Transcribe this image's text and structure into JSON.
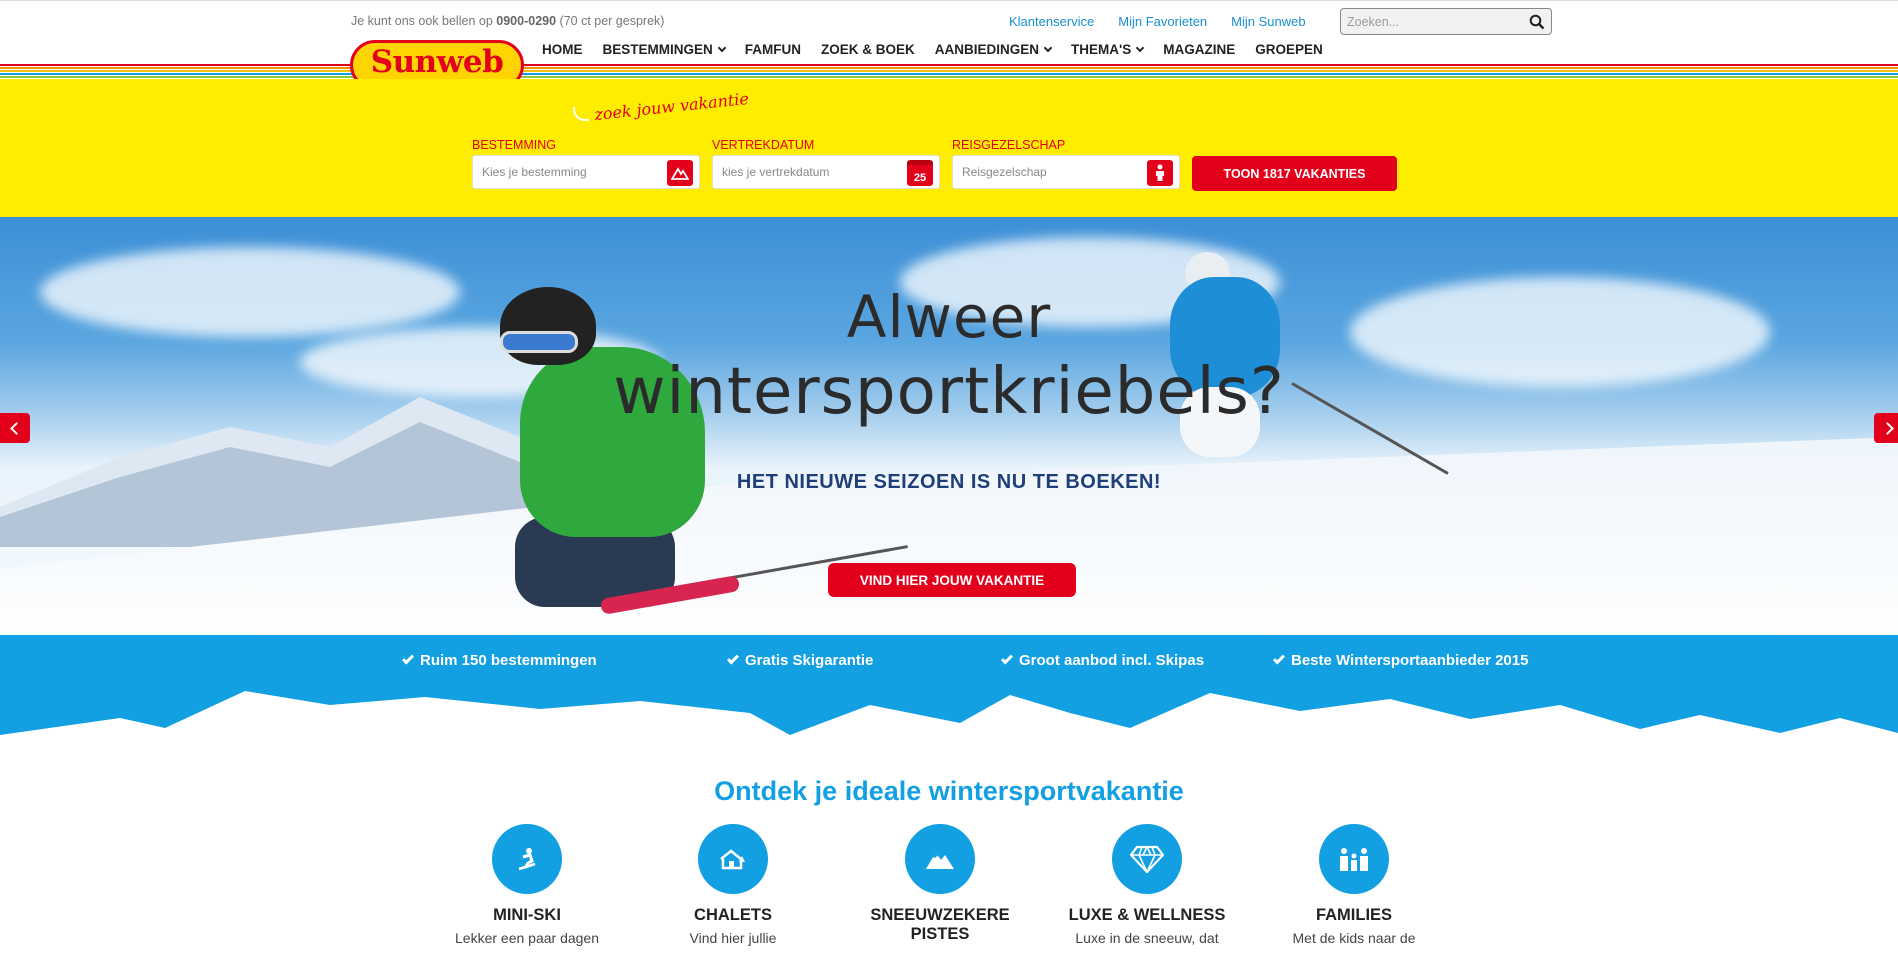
{
  "topbar": {
    "phone_prefix": "Je kunt ons ook bellen op",
    "phone_number": "0900-0290",
    "phone_suffix": "(70 ct per gesprek)",
    "links": [
      "Klantenservice",
      "Mijn Favorieten",
      "Mijn Sunweb"
    ],
    "search_placeholder": "Zoeken..."
  },
  "logo": {
    "text": "Sunweb"
  },
  "nav": {
    "home": "HOME",
    "bestemmingen": "BESTEMMINGEN",
    "famfun": "FAMFUN",
    "zoek_boek": "ZOEK & BOEK",
    "aanbiedingen": "AANBIEDINGEN",
    "themas": "THEMA'S",
    "magazine": "MAGAZINE",
    "groepen": "GROEPEN"
  },
  "searchbar": {
    "tagline": "zoek jouw vakantie",
    "destination": {
      "label": "BESTEMMING",
      "placeholder": "Kies je bestemming"
    },
    "date": {
      "label": "VERTREKDATUM",
      "placeholder": "kies je vertrekdatum",
      "calendar_day": "25"
    },
    "party": {
      "label": "REISGEZELSCHAP",
      "placeholder": "Reisgezelschap"
    },
    "submit": "TOON 1817 VAKANTIES"
  },
  "hero": {
    "headline_line1": "Alweer",
    "headline_line2": "wintersportkriebels?",
    "subtitle": "HET NIEUWE SEIZOEN IS NU TE BOEKEN!",
    "cta": "VIND HIER JOUW VAKANTIE"
  },
  "usps": [
    "Ruim 150 bestemmingen",
    "Gratis Skigarantie",
    "Groot aanbod incl. Skipas",
    "Beste Wintersportaanbieder 2015"
  ],
  "discover": {
    "title": "Ontdek je ideale wintersportvakantie",
    "categories": [
      {
        "name": "MINI-SKI",
        "desc": "Lekker een paar dagen",
        "icon": "snowboarder-icon"
      },
      {
        "name": "CHALETS",
        "desc": "Vind hier jullie",
        "icon": "chalet-icon"
      },
      {
        "name": "SNEEUWZEKERE PISTES",
        "desc": "",
        "icon": "mountain-icon"
      },
      {
        "name": "LUXE & WELLNESS",
        "desc": "Luxe in de sneeuw, dat",
        "icon": "diamond-icon"
      },
      {
        "name": "FAMILIES",
        "desc": "Met de kids naar de",
        "icon": "family-icon"
      }
    ]
  },
  "colors": {
    "brand_red": "#e3001b",
    "brand_yellow": "#ffed00",
    "brand_blue": "#13a0e3"
  }
}
